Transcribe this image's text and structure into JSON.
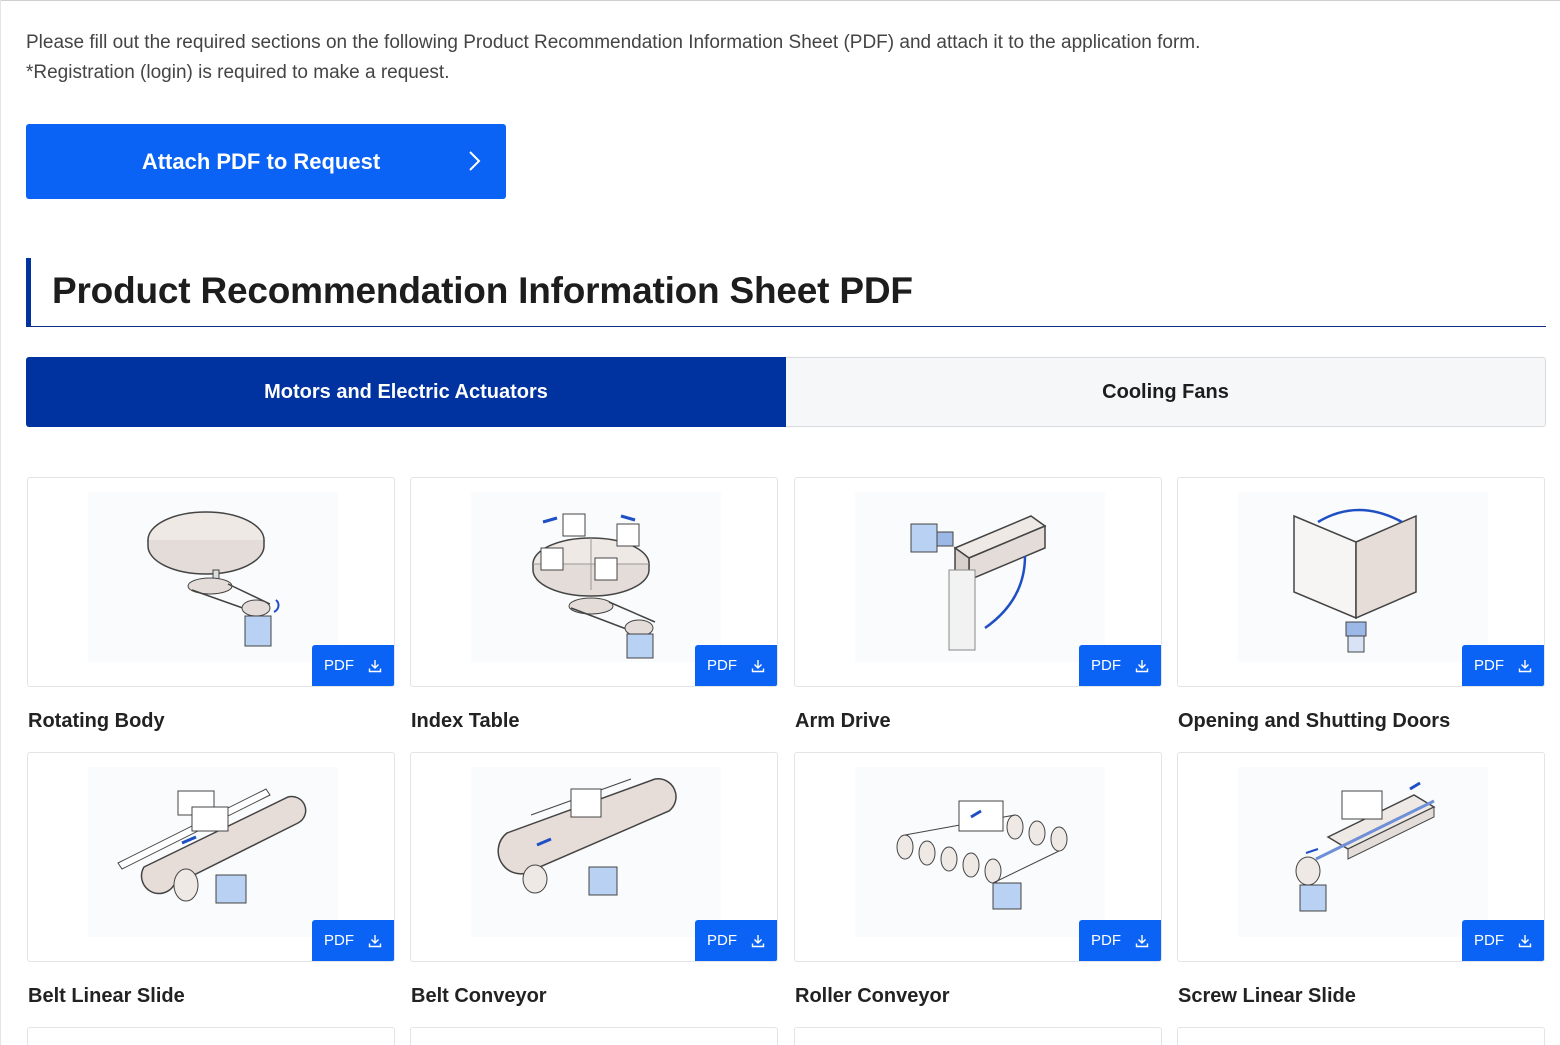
{
  "intro": {
    "line1": "Please fill out the required sections on the following Product Recommendation Information Sheet (PDF) and attach it to the application form.",
    "line2": "*Registration (login) is required to make a request."
  },
  "attach_button": {
    "label": "Attach PDF to Request",
    "icon": "chevron-right-icon"
  },
  "section": {
    "title": "Product Recommendation Information Sheet PDF"
  },
  "tabs": [
    {
      "label": "Motors and Electric Actuators",
      "active": true
    },
    {
      "label": "Cooling Fans",
      "active": false
    }
  ],
  "pdf_label": "PDF",
  "colors": {
    "primary": "#0a63f5",
    "navy": "#0033a0",
    "tab_inactive_bg": "#f6f7f9"
  },
  "cards": [
    {
      "name": "Rotating Body",
      "icon": "rotating-body-illustration"
    },
    {
      "name": "Index Table",
      "icon": "index-table-illustration"
    },
    {
      "name": "Arm Drive",
      "icon": "arm-drive-illustration"
    },
    {
      "name": "Opening and Shutting Doors",
      "icon": "doors-illustration"
    },
    {
      "name": "Belt Linear Slide",
      "icon": "belt-linear-slide-illustration"
    },
    {
      "name": "Belt Conveyor",
      "icon": "belt-conveyor-illustration"
    },
    {
      "name": "Roller Conveyor",
      "icon": "roller-conveyor-illustration"
    },
    {
      "name": "Screw Linear Slide",
      "icon": "screw-linear-slide-illustration"
    }
  ]
}
